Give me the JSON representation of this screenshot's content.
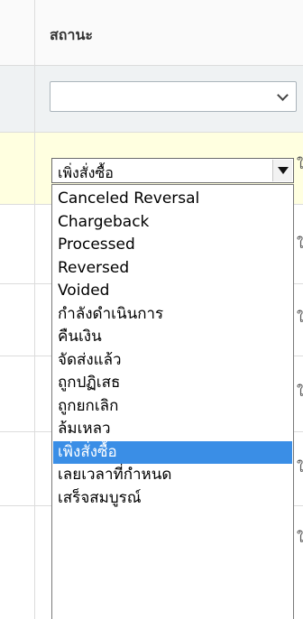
{
  "table": {
    "status_header": "สถานะ",
    "filter_value": ""
  },
  "status_select": {
    "value": "เพิ่งสั่งซื้อ"
  },
  "dropdown": {
    "options": [
      "Canceled Reversal",
      "Chargeback",
      "Processed",
      "Reversed",
      "Voided",
      "กำลังดำเนินการ",
      "คืนเงิน",
      "จัดส่งแล้ว",
      "ถูกปฏิเสธ",
      "ถูกยกเลิก",
      "ล้มเหลว",
      "เพิ่งสั่งซื้อ",
      "เลยเวลาที่กำหนด",
      "เสร็จสมบูรณ์"
    ],
    "selected_index": 11
  },
  "clipped_edge_text": [
    "ใ",
    "ใ",
    "ใ",
    "ใ",
    "ใ",
    "ใ"
  ],
  "colors": {
    "highlight_row": "#ffffe0",
    "filter_row": "#eff2f3",
    "selected_option": "#3a8ee6"
  }
}
